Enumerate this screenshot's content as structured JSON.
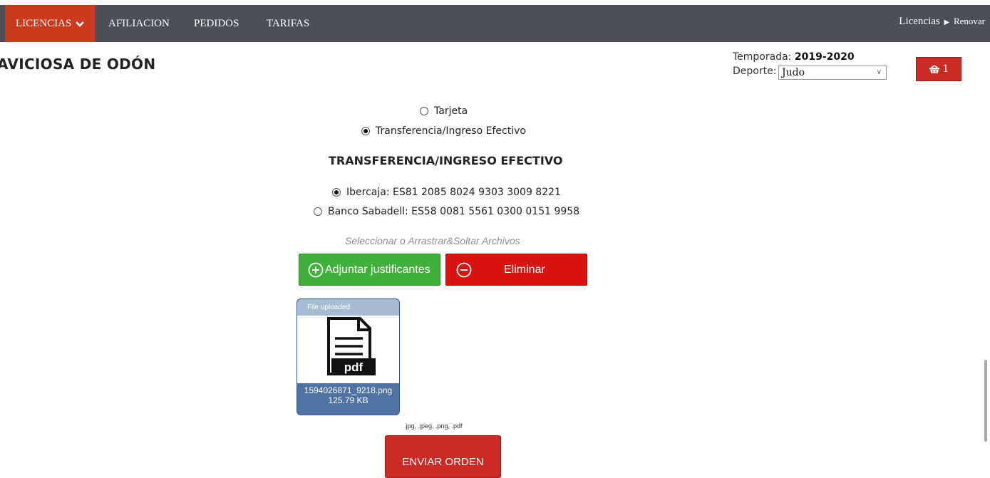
{
  "nav": {
    "items": [
      {
        "label": "LICENCIAS"
      },
      {
        "label": "AFILIACION"
      },
      {
        "label": "PEDIDOS"
      },
      {
        "label": "TARIFAS"
      }
    ],
    "breadcrumb": {
      "parent": "Licencias",
      "current": "Renovar"
    }
  },
  "header": {
    "club_name": "AVICIOSA DE ODÓN",
    "season_label": "Temporada:",
    "season_value": "2019-2020",
    "sport_label": "Deporte:",
    "sport_value": "Judo",
    "cart_count": "1"
  },
  "payment": {
    "options": [
      {
        "label": "Tarjeta",
        "checked": false
      },
      {
        "label": "Transferencia/Ingreso Efectivo",
        "checked": true
      }
    ],
    "section_title": "TRANSFERENCIA/INGRESO EFECTIVO",
    "banks": [
      {
        "label": "Ibercaja: ES81 2085 8024 9303 3009 8221",
        "checked": true
      },
      {
        "label": "Banco Sabadell: ES58 0081 5561 0300 0151 9958",
        "checked": false
      }
    ]
  },
  "upload": {
    "hint": "Seleccionar o Arrastrar&Soltar Archivos",
    "attach_label": "Adjuntar justificantes",
    "delete_label": "Eliminar",
    "file": {
      "status": "File uploaded",
      "icon_label": "pdf",
      "name": "1594026871_9218.png",
      "size": "125.79 KB"
    },
    "allowed_types": ".jpg, .jpeg, .png, .pdf"
  },
  "submit_label": "ENVIAR ORDEN",
  "colors": {
    "nav_bg": "#4b5056",
    "accent_red": "#cc2a24",
    "nav_active": "#cc3a1c",
    "attach_green": "#3fb13a",
    "delete_red": "#d9130f",
    "file_card_blue": "#4f73a3"
  }
}
